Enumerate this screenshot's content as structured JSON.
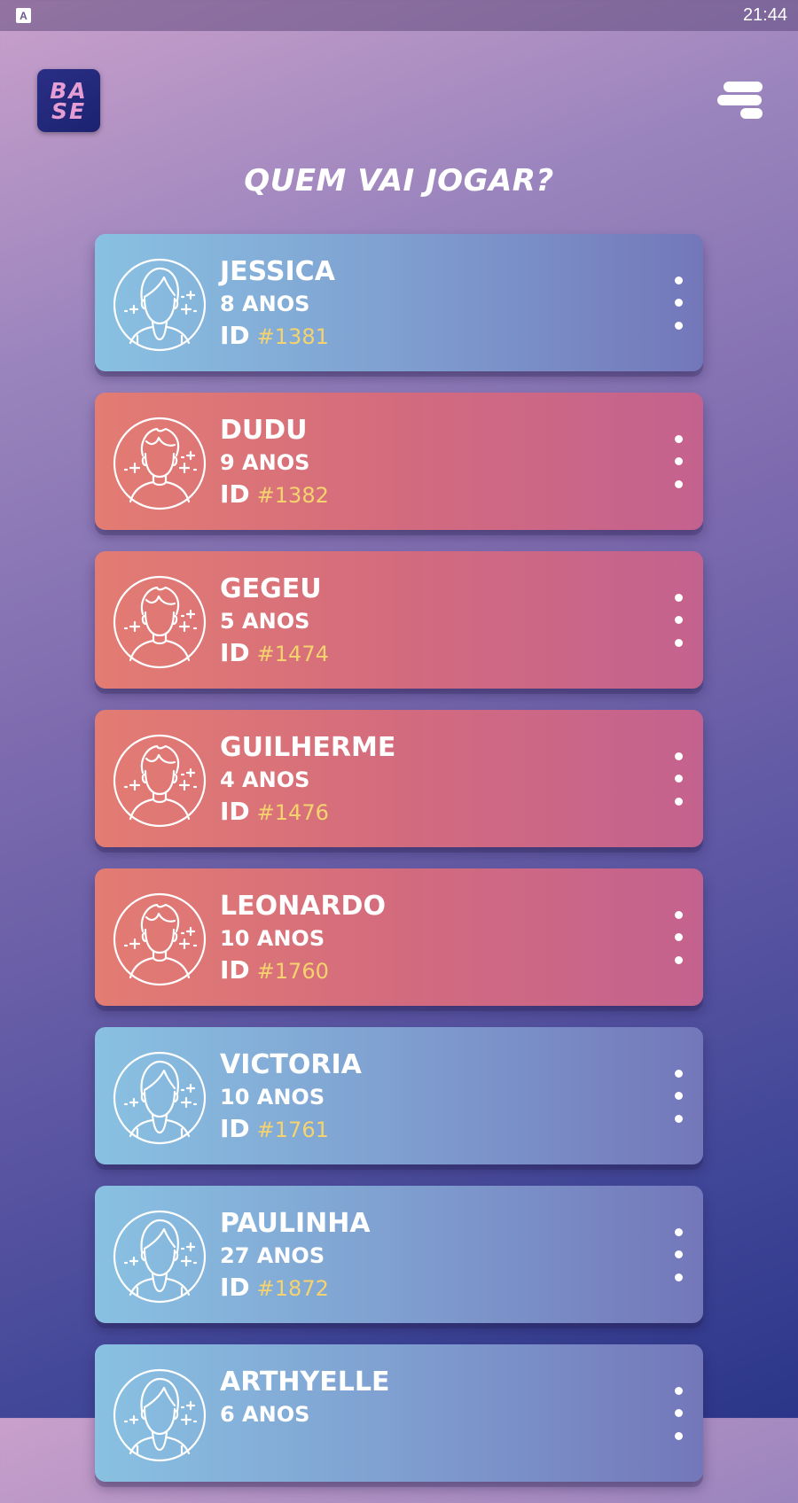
{
  "status_bar": {
    "time": "21:44",
    "app_icon_letter": "A"
  },
  "logo": {
    "line1": "BA",
    "line2": "SE"
  },
  "title": "QUEM VAI JOGAR?",
  "id_label": "ID",
  "profiles": [
    {
      "name": "JESSICA",
      "age": "8 ANOS",
      "id": "#1381",
      "theme": "blue",
      "avatar": "girl-avatar-icon"
    },
    {
      "name": "DUDU",
      "age": "9 ANOS",
      "id": "#1382",
      "theme": "red",
      "avatar": "boy-avatar-icon"
    },
    {
      "name": "GEGEU",
      "age": "5 ANOS",
      "id": "#1474",
      "theme": "red",
      "avatar": "boy-avatar-icon"
    },
    {
      "name": "GUILHERME",
      "age": "4 ANOS",
      "id": "#1476",
      "theme": "red",
      "avatar": "boy-avatar-icon"
    },
    {
      "name": "LEONARDO",
      "age": "10 ANOS",
      "id": "#1760",
      "theme": "red",
      "avatar": "boy-avatar-icon"
    },
    {
      "name": "VICTORIA",
      "age": "10 ANOS",
      "id": "#1761",
      "theme": "blue",
      "avatar": "girl-avatar-icon"
    },
    {
      "name": "PAULINHA",
      "age": "27 ANOS",
      "id": "#1872",
      "theme": "blue",
      "avatar": "girl-avatar-icon"
    },
    {
      "name": "ARTHYELLE",
      "age": "6 ANOS",
      "id": "",
      "theme": "blue",
      "avatar": "girl-avatar-icon"
    }
  ],
  "colors": {
    "card_blue_start": "#89c1e2",
    "card_blue_end": "#7377ba",
    "card_red_start": "#e37c72",
    "card_red_end": "#c4628f",
    "id_accent": "#f5d36e"
  }
}
